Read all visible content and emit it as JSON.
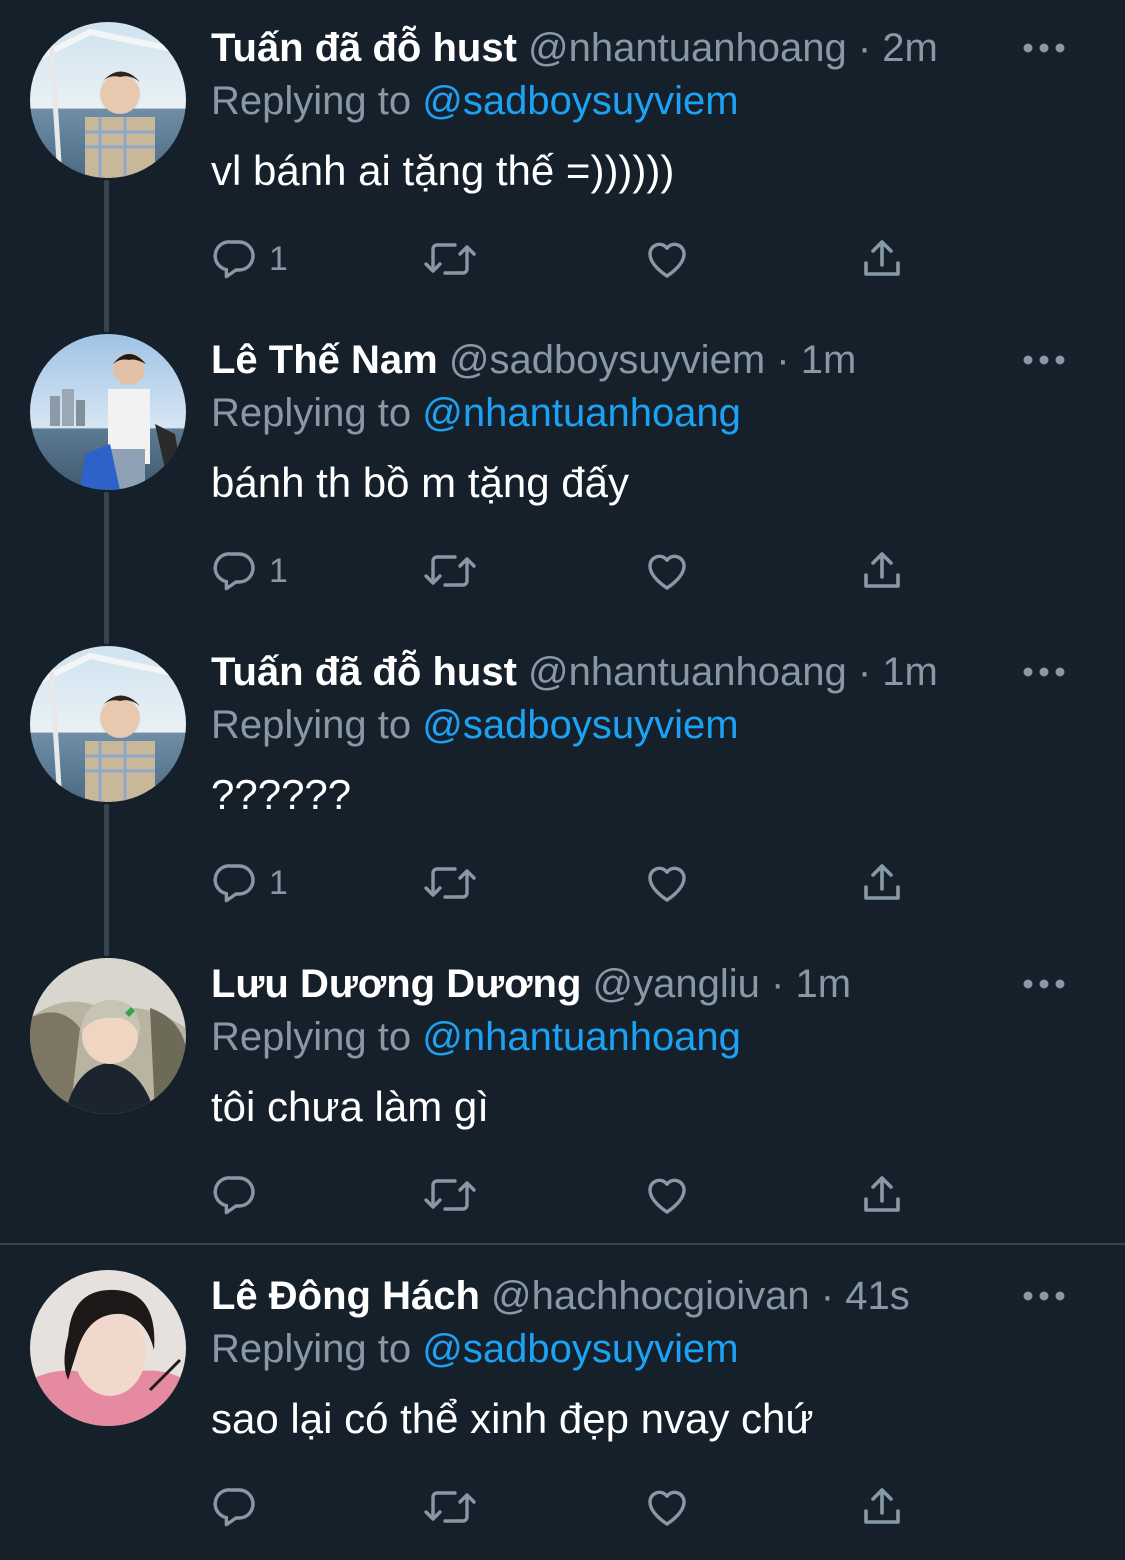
{
  "colors": {
    "background": "#15202b",
    "text": "#ffffff",
    "secondary": "#8899a6",
    "accent": "#1da1f2",
    "divider": "#38444d"
  },
  "tweets": [
    {
      "name": "Tuấn đã đỗ hust",
      "handle": "@nhantuanhoang",
      "dot": "·",
      "time": "2m",
      "replying_label": "Replying to",
      "replying_to": "@sadboysuyviem",
      "text": "vl bánh ai tặng thế =))))))",
      "reply_count": "1",
      "avatar_icon": "avatar-boat-photo"
    },
    {
      "name": "Lê Thế Nam",
      "handle": "@sadboysuyviem",
      "dot": "·",
      "time": "1m",
      "replying_label": "Replying to",
      "replying_to": "@nhantuanhoang",
      "text": "bánh th bồ m tặng đấy",
      "reply_count": "1",
      "avatar_icon": "avatar-city-photo"
    },
    {
      "name": "Tuấn đã đỗ hust",
      "handle": "@nhantuanhoang",
      "dot": "·",
      "time": "1m",
      "replying_label": "Replying to",
      "replying_to": "@sadboysuyviem",
      "text": "??????",
      "reply_count": "1",
      "avatar_icon": "avatar-boat-photo"
    },
    {
      "name": "Lưu Dương Dương",
      "handle": "@yangliu",
      "dot": "·",
      "time": "1m",
      "replying_label": "Replying to",
      "replying_to": "@nhantuanhoang",
      "text": "tôi chưa làm gì",
      "reply_count": "",
      "avatar_icon": "avatar-outdoor-photo"
    },
    {
      "name": "Lê Đông Hách",
      "handle": "@hachhocgioivan",
      "dot": "·",
      "time": "41s",
      "replying_label": "Replying to",
      "replying_to": "@sadboysuyviem",
      "text": "sao lại có thể xinh đẹp nvay chứ",
      "reply_count": "",
      "avatar_icon": "avatar-pink-hoodie-photo"
    }
  ]
}
